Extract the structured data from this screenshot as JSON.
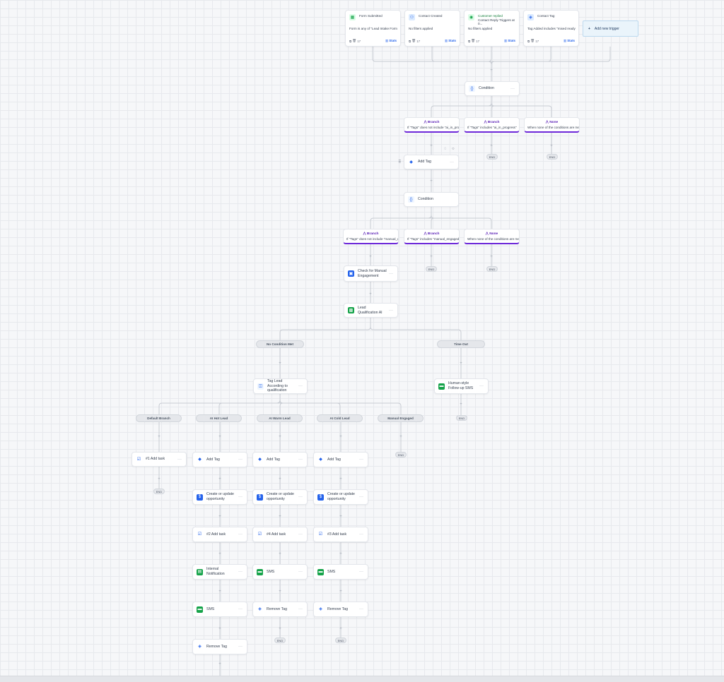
{
  "colors": {
    "accent_blue": "#2563eb",
    "branch_purple": "#6d28d9",
    "green": "#16a34a",
    "wire": "#c8ccd3"
  },
  "triggers": [
    {
      "title": "Form Submitted",
      "icon": "form-icon",
      "glyph": "▦",
      "icon_color": "#16a34a",
      "desc": "Form is any of \"Lead Intake Form ...",
      "count": "17",
      "stats": "Stats"
    },
    {
      "title": "Contact Created",
      "icon": "user-plus-icon",
      "glyph": "⚇",
      "icon_color": "#2563eb",
      "desc": "No filters applied",
      "count": "17",
      "stats": "Stats"
    },
    {
      "title": "Customer replied",
      "subtitle": "Contact Reply Triggers at 0...",
      "icon": "chat-reply-icon",
      "glyph": "◉",
      "icon_color": "#16a34a",
      "desc": "No filters applied",
      "count": "17",
      "stats": "Stats"
    },
    {
      "title": "Contact Tag",
      "icon": "tag-icon",
      "glyph": "◈",
      "icon_color": "#2563eb",
      "desc": "Tag Added includes \"mixed ready\"",
      "count": "17",
      "stats": "Stats"
    }
  ],
  "add_trigger": {
    "label": "Add new trigger",
    "plus": "+"
  },
  "top_condition": {
    "label": "Condition",
    "glyph": "{}"
  },
  "top_branches": [
    {
      "title": "Branch",
      "desc": "If \"Tags\" does not include \"ai_in_pro..."
    },
    {
      "title": "Branch",
      "desc": "If \"Tags\" includes \"ai_in_progress\""
    },
    {
      "title": "None",
      "desc": "When none of the conditions are met"
    }
  ],
  "add_tag_top": {
    "label": "Add Tag",
    "glyph": "◆"
  },
  "condition2": {
    "label": "Condition",
    "glyph": "{}"
  },
  "mid_branches": [
    {
      "title": "Branch",
      "desc": "If \"Tags\" does not include \"manual_en..."
    },
    {
      "title": "Branch",
      "desc": "If \"Tags\" includes \"manual_engaged\""
    },
    {
      "title": "None",
      "desc": "When none of the conditions are met"
    }
  ],
  "check_manual": {
    "label": "Check for Manual Engagement",
    "glyph": "▣"
  },
  "qualification": {
    "label": "Lead Qualification AI",
    "glyph": "▩"
  },
  "outcomes": {
    "met": "No Condition Met",
    "timeout": "Time Out"
  },
  "tag_lead": {
    "label": "Tag Lead According to qualification",
    "glyph": "◫"
  },
  "followup": {
    "label": "Human-style Follow-up SMS",
    "glyph": "▬"
  },
  "lead_branches": [
    "Default Branch",
    "AI Hot Lead",
    "AI Warm Lead",
    "AI Cold Lead",
    "Manual Engaged"
  ],
  "default_task": {
    "label": "#1 Add task"
  },
  "hot_steps": [
    {
      "label": "Add Tag",
      "kind": "tag"
    },
    {
      "label": "Create or update opportunity",
      "kind": "opp"
    },
    {
      "label": "#2 Add task",
      "kind": "task"
    },
    {
      "label": "Internal Notification",
      "kind": "notify"
    },
    {
      "label": "SMS",
      "kind": "sms"
    },
    {
      "label": "Remove Tag",
      "kind": "remove"
    }
  ],
  "warm_steps": [
    {
      "label": "Add Tag",
      "kind": "tag"
    },
    {
      "label": "Create or update opportunity",
      "kind": "opp"
    },
    {
      "label": "#4 Add task",
      "kind": "task"
    },
    {
      "label": "SMS",
      "kind": "sms"
    },
    {
      "label": "Remove Tag",
      "kind": "remove"
    }
  ],
  "cold_steps": [
    {
      "label": "Add Tag",
      "kind": "tag"
    },
    {
      "label": "Create or update opportunity",
      "kind": "opp"
    },
    {
      "label": "#3 Add task",
      "kind": "task"
    },
    {
      "label": "SMS",
      "kind": "sms"
    },
    {
      "label": "Remove Tag",
      "kind": "remove"
    }
  ],
  "end_label": "END",
  "menu_glyph": "···",
  "plus_glyph": "+"
}
